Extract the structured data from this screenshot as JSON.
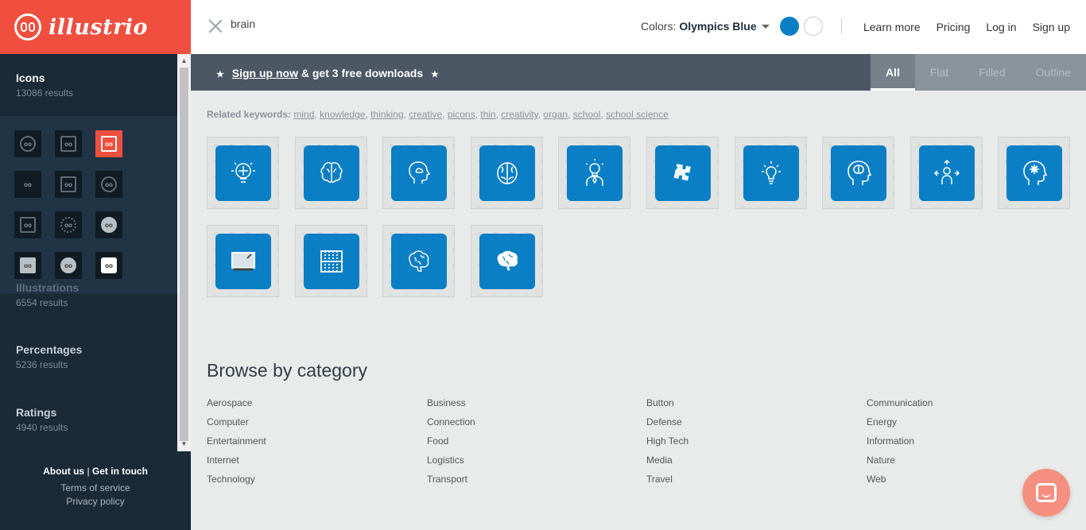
{
  "brand": {
    "name": "illustrio"
  },
  "search": {
    "query": "brain"
  },
  "colors": {
    "label": "Colors:",
    "selected": "Olympics Blue",
    "accent": "#0a7fc5",
    "brand": "#f04e3e"
  },
  "nav": {
    "links": [
      "Learn more",
      "Pricing",
      "Log in",
      "Sign up"
    ]
  },
  "promo": {
    "link": "Sign up now",
    "rest": "& get 3 free downloads",
    "star": "★"
  },
  "tabs": [
    "All",
    "Flat",
    "Filled",
    "Outline"
  ],
  "sidebar": {
    "categories": [
      {
        "name": "Icons",
        "count": "13086 results"
      },
      {
        "name": "Illustrations",
        "count": "6554 results"
      },
      {
        "name": "Percentages",
        "count": "5236 results"
      },
      {
        "name": "Ratings",
        "count": "4940 results"
      }
    ],
    "footer": {
      "about": "About us",
      "sep": "|",
      "contact": "Get in touch",
      "terms": "Terms of service",
      "privacy": "Privacy policy"
    }
  },
  "related": {
    "label": "Related keywords:",
    "keywords": [
      "mind",
      "knowledge",
      "thinking",
      "creative",
      "picons",
      "thin",
      "creativity",
      "organ",
      "school",
      "school science"
    ]
  },
  "results": [
    {
      "icon": "lightbulb-brain-icon"
    },
    {
      "icon": "brain-outline-icon"
    },
    {
      "icon": "head-cloud-icon"
    },
    {
      "icon": "brain-icon"
    },
    {
      "icon": "person-idea-icon"
    },
    {
      "icon": "puzzle-pieces-icon"
    },
    {
      "icon": "lightbulb-icon"
    },
    {
      "icon": "head-brain-icon"
    },
    {
      "icon": "person-arrows-icon"
    },
    {
      "icon": "head-gear-icon"
    },
    {
      "icon": "chalkboard-icon"
    },
    {
      "icon": "abacus-icon"
    },
    {
      "icon": "brain-sketch-icon"
    },
    {
      "icon": "brain-filled-icon"
    }
  ],
  "browse": {
    "title": "Browse by category",
    "columns": [
      [
        "Aerospace",
        "Computer",
        "Entertainment",
        "Internet",
        "Technology"
      ],
      [
        "Business",
        "Connection",
        "Food",
        "Logistics",
        "Transport"
      ],
      [
        "Button",
        "Defense",
        "High Tech",
        "Media",
        "Travel"
      ],
      [
        "Communication",
        "Energy",
        "Information",
        "Nature",
        "Web"
      ]
    ]
  }
}
